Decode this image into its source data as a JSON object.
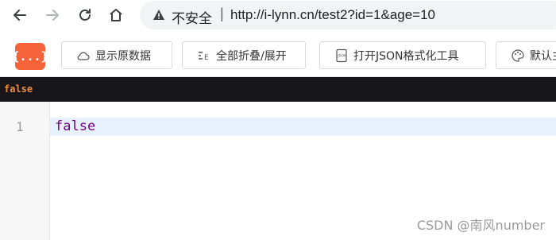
{
  "browser": {
    "insecure_label": "不安全",
    "separator": "|",
    "url": "http://i-lynn.cn/test2?id=1&age=10"
  },
  "toolbar": {
    "logo_text": "{...}",
    "buttons": [
      {
        "label": "显示原数据",
        "icon": "cloud-icon"
      },
      {
        "label": "全部折叠/展开",
        "icon": "collapse-icon"
      },
      {
        "label": "打开JSON格式化工具",
        "icon": "json-file-icon"
      },
      {
        "label": "默认主",
        "icon": "palette-icon"
      }
    ]
  },
  "raw": {
    "text": "false"
  },
  "editor": {
    "line_number": "1",
    "value": "false"
  },
  "watermark": "CSDN @南风number",
  "colors": {
    "logo": "#f5633b",
    "raw_bg": "#17171b",
    "raw_text": "#f08a3e",
    "keyword": "#770088",
    "active_line": "#e8f2ff"
  }
}
